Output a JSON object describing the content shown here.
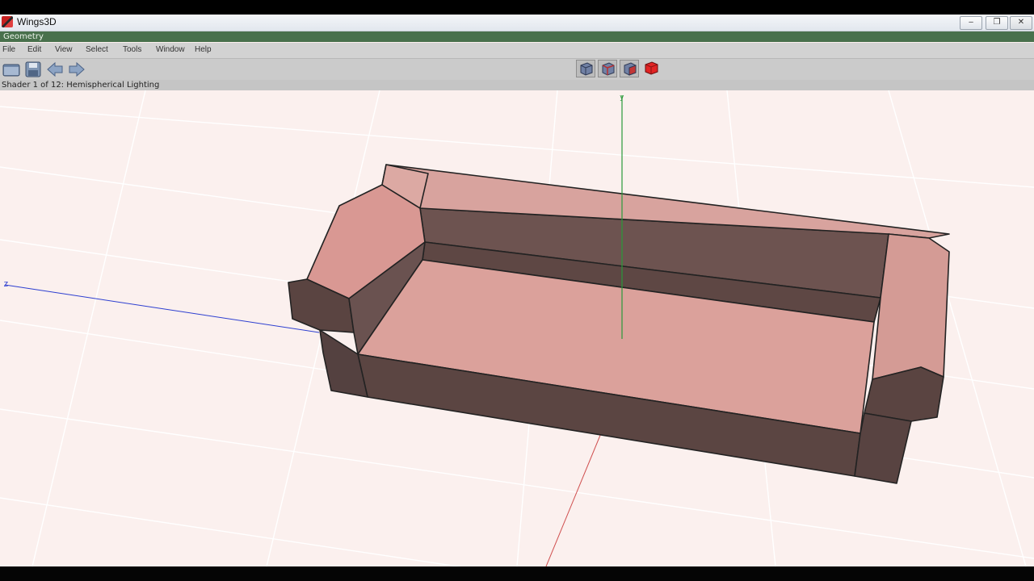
{
  "window": {
    "title": "Wings3D",
    "controls": {
      "minimize": "‒",
      "maximize": "❐",
      "close": "✕"
    }
  },
  "geometry_bar": {
    "label": "Geometry"
  },
  "menu": [
    "File",
    "Edit",
    "View",
    "Select",
    "Tools",
    "Window",
    "Help"
  ],
  "toolbar": {
    "buttons": [
      "open-icon",
      "save-icon",
      "undo-arrow-icon",
      "redo-arrow-icon"
    ],
    "selection_modes": [
      "vertex",
      "edge",
      "face",
      "body"
    ],
    "active_selection_mode": "body"
  },
  "info_line": {
    "text": "Shader 1 of 12: Hemispherical Lighting"
  },
  "viewport": {
    "axis_labels": {
      "z": "z",
      "y": "y"
    },
    "background_color": "#fbf0ee",
    "model_color": "#d99893",
    "grid_color": "#ffffff"
  }
}
